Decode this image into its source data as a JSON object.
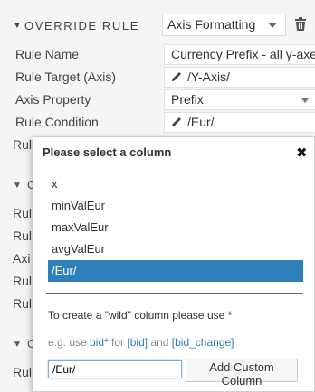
{
  "header": {
    "title": "OVERRIDE RULE",
    "select_value": "Axis Formatting",
    "toggle_icon": "triangle-down",
    "delete_icon": "trash-icon"
  },
  "rows": [
    {
      "label": "Rule Name",
      "value": "Currency Prefix - all y-axes",
      "icon": ""
    },
    {
      "label": "Rule Target (Axis)",
      "value": "/Y-Axis/",
      "icon": "pencil-icon"
    },
    {
      "label": "Axis Property",
      "value": "Prefix",
      "icon": "dropdown"
    },
    {
      "label": "Rule Condition",
      "value": "/Eur/",
      "icon": "pencil-icon"
    }
  ],
  "background_stubs": {
    "row5": "Rul",
    "sec2_toggle": "▼",
    "sec2_title": "O",
    "row6": "Rul",
    "row7": "Rul",
    "row8": "Axi",
    "row9": "Rul",
    "row10": "Rul",
    "sec3_toggle": "▼",
    "sec3_title": "O",
    "row11": "Rul"
  },
  "popup": {
    "title": "Please select a column",
    "close_icon": "close-icon",
    "columns": [
      "x",
      "minValEur",
      "maxValEur",
      "avgValEur",
      "/Eur/"
    ],
    "selected_index": 4,
    "hint_line1": "To create a \"wild\" column please use *",
    "hint_line2": {
      "prefix": "e.g. use ",
      "hl1": "bid*",
      "mid1": " for ",
      "hl2": "[bid]",
      "mid2": " and ",
      "hl3": "[bid_change]"
    },
    "custom_input_value": "/Eur/",
    "add_button_label": "Add Custom Column"
  },
  "colors": {
    "selected_bg": "#2f7fbb",
    "link_color": "#2f7fbb",
    "panel_bg": "#f5f5f5"
  }
}
